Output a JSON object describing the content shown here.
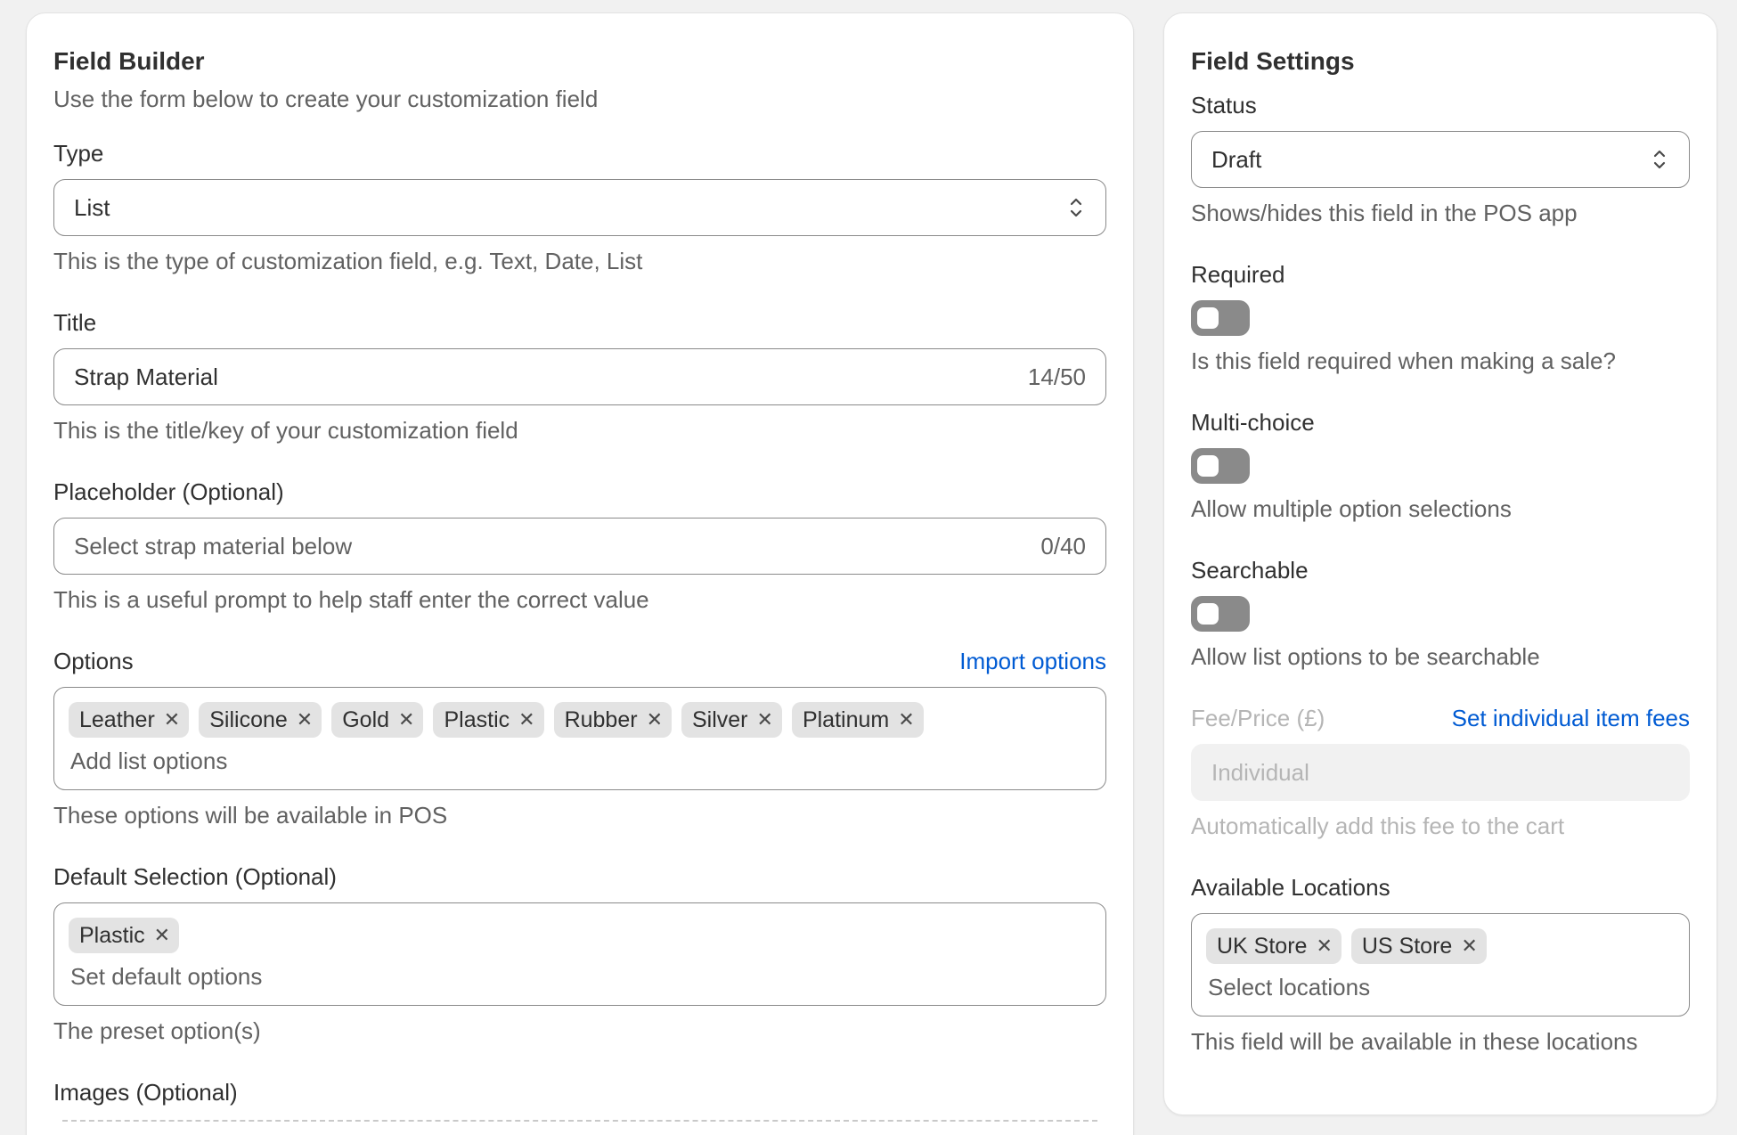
{
  "builder": {
    "title": "Field Builder",
    "subtitle": "Use the form below to create your customization field",
    "type": {
      "label": "Type",
      "value": "List",
      "help": "This is the type of customization field, e.g. Text, Date, List"
    },
    "title_field": {
      "label": "Title",
      "value": "Strap Material",
      "counter": "14/50",
      "help": "This is the title/key of your customization field"
    },
    "placeholder_field": {
      "label": "Placeholder (Optional)",
      "placeholder": "Select strap material below",
      "counter": "0/40",
      "help": "This is a useful prompt to help staff enter the correct value"
    },
    "options": {
      "label": "Options",
      "import_link": "Import options",
      "tags": [
        "Leather",
        "Silicone",
        "Gold",
        "Plastic",
        "Rubber",
        "Silver",
        "Platinum"
      ],
      "input_placeholder": "Add list options",
      "help": "These options will be available in POS"
    },
    "default_selection": {
      "label": "Default Selection (Optional)",
      "tags": [
        "Plastic"
      ],
      "input_placeholder": "Set default options",
      "help": "The preset option(s)"
    },
    "images": {
      "label": "Images (Optional)"
    }
  },
  "settings": {
    "title": "Field Settings",
    "status": {
      "label": "Status",
      "value": "Draft",
      "help": "Shows/hides this field in the POS app"
    },
    "required": {
      "label": "Required",
      "help": "Is this field required when making a sale?"
    },
    "multi_choice": {
      "label": "Multi-choice",
      "help": "Allow multiple option selections"
    },
    "searchable": {
      "label": "Searchable",
      "help": "Allow list options to be searchable"
    },
    "fee": {
      "label": "Fee/Price (£)",
      "link": "Set individual item fees",
      "value": "Individual",
      "help": "Automatically add this fee to the cart"
    },
    "locations": {
      "label": "Available Locations",
      "tags": [
        "UK Store",
        "US Store"
      ],
      "input_placeholder": "Select locations",
      "help": "This field will be available in these locations"
    }
  },
  "icons": {
    "select": "chevron-up-down-icon",
    "remove": "x-icon"
  },
  "colors": {
    "link": "#005bd3",
    "toggle_off": "#8a8a8a",
    "tag_bg": "#e3e3e3"
  }
}
